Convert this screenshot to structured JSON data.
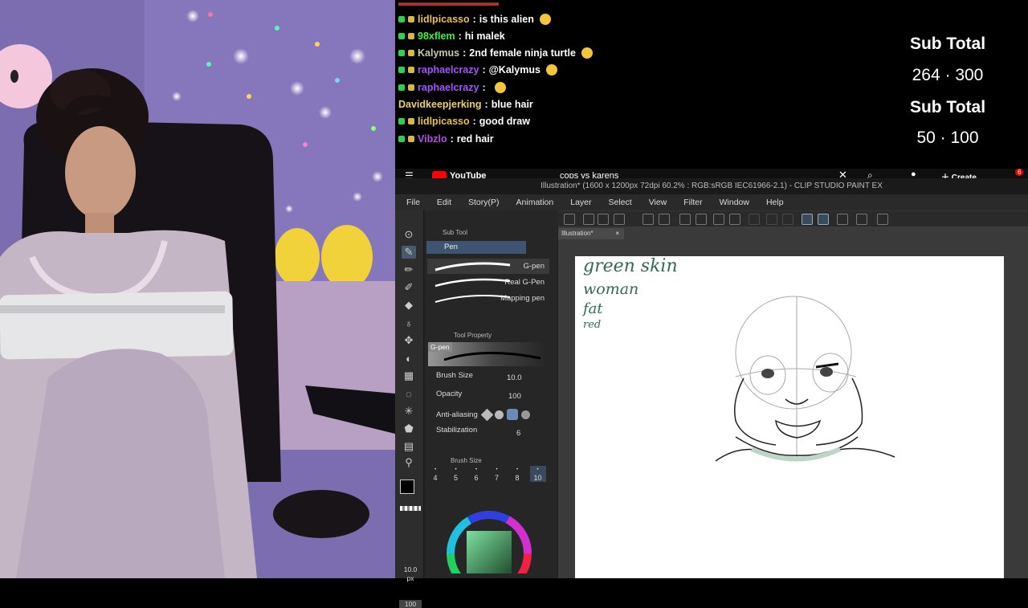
{
  "chat": {
    "messages": [
      {
        "user": "lidlpicasso",
        "text": "is this alien",
        "emote": "thinking-emote",
        "color": "#e7c14a"
      },
      {
        "user": "98xflem",
        "text": "hi malek",
        "emote": "",
        "color": "#3ff241"
      },
      {
        "user": "Kalymus",
        "text": "2nd female ninja turtle",
        "emote": "skull-emote",
        "color": "#c9c9a8"
      },
      {
        "user": "raphaelcrazy",
        "text": "@Kalymus",
        "emote": "face-emote",
        "color": "#a354ff"
      },
      {
        "user": "raphaelcrazy",
        "text": "",
        "emote": "smile-emote",
        "color": "#a354ff"
      },
      {
        "user": "Davidkeepjerking",
        "text": "blue hair",
        "emote": "",
        "color": "#ead26c"
      },
      {
        "user": "lidlpicasso",
        "text": "good draw",
        "emote": "",
        "color": "#e7c14a"
      },
      {
        "user": "Vibzlo",
        "text": "red hair",
        "emote": "",
        "color": "#b64fe0"
      }
    ],
    "separator": ":"
  },
  "sub_goals": [
    {
      "title": "Sub Total",
      "value": "264 · 300"
    },
    {
      "title": "Sub Total",
      "value": "50 · 100"
    }
  ],
  "youtube": {
    "logo": "YouTube",
    "search": "cops vs karens",
    "create": "Create",
    "notif": "6"
  },
  "csp": {
    "title": "Illustration* (1600 x 1200px 72dpi 60.2% : RGB:sRGB IEC61966-2.1) - CLIP STUDIO PAINT EX",
    "menu": [
      "File",
      "Edit",
      "Story(P)",
      "Animation",
      "Layer",
      "Select",
      "View",
      "Filter",
      "Window",
      "Help"
    ],
    "subtool_header": "Sub Tool",
    "subtool_tab": "Pen",
    "brushes": [
      "G-pen",
      "Real G-Pen",
      "Mapping pen"
    ],
    "toolprop_header": "Tool Property",
    "toolprop_brush": "G-pen",
    "brush_size_label": "Brush Size",
    "brush_size": "10.0",
    "opacity_label": "Opacity",
    "opacity": "100",
    "antialias_label": "Anti-aliasing",
    "stabilization_label": "Stabilization",
    "stabilization": "6",
    "brushsize_header": "Brush Size",
    "sizes": [
      "4",
      "5",
      "6",
      "7",
      "8",
      "10"
    ],
    "size_px": "10.0",
    "size_unit": "px",
    "opacity_bottom": "100",
    "canvas_tab": "Illustration*",
    "notes": [
      "green skin",
      "woman",
      "fat",
      "red"
    ]
  }
}
